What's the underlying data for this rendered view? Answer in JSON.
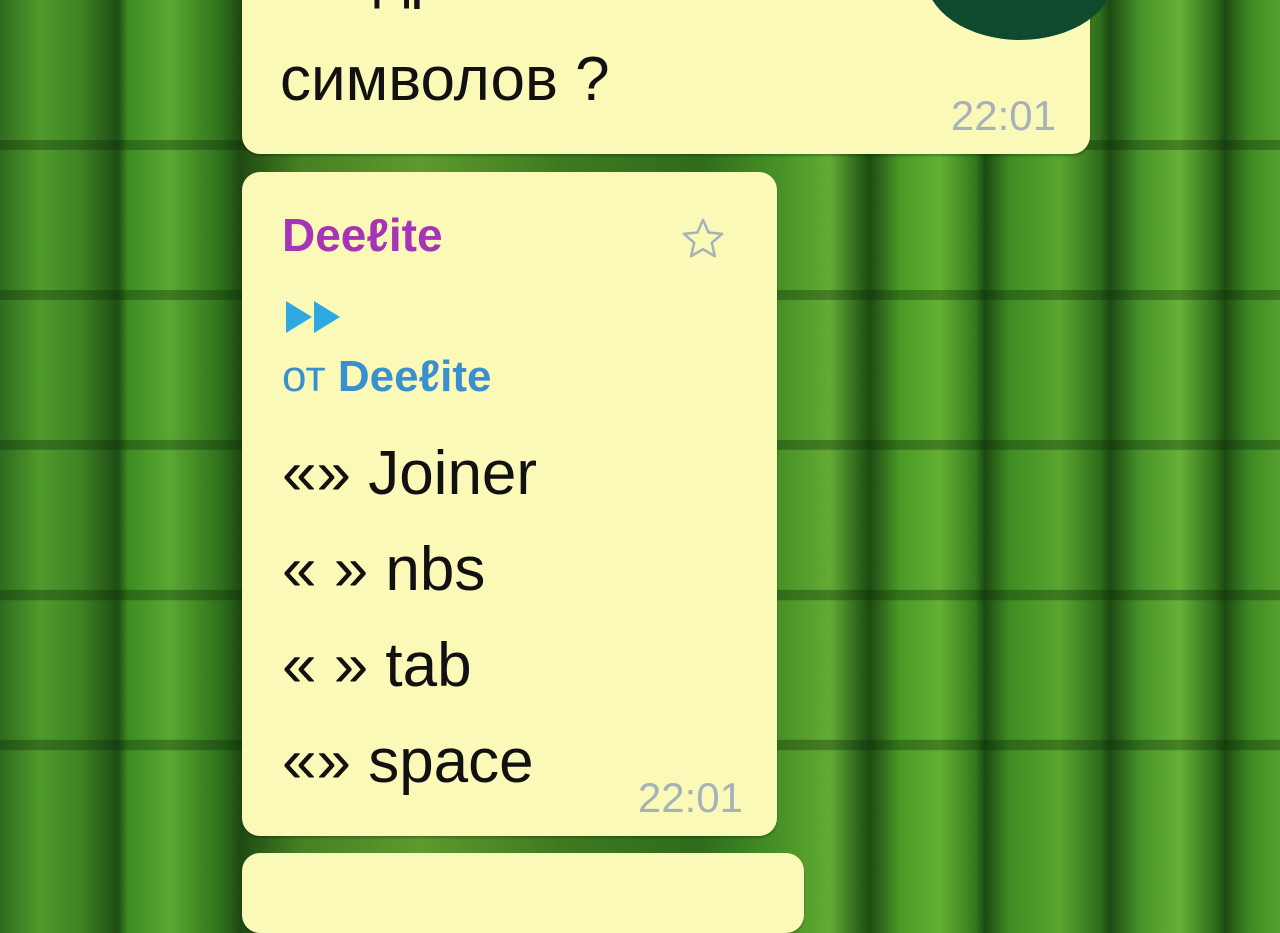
{
  "messages": [
    {
      "text_lines": [
        "квадратики вмес",
        "символов ?"
      ],
      "time": "22:01"
    },
    {
      "sender": "Deeℓite",
      "forwarded_prefix": "от",
      "forwarded_from": "Deeℓite",
      "text_lines": [
        "«‌» Joiner",
        "« » nbs",
        "«\t» tab",
        "«​» space"
      ],
      "time": "22:01"
    }
  ],
  "icons": {
    "star": "star-outline-icon",
    "forward": "forward-arrows-icon"
  },
  "colors": {
    "bubble": "#fbf9b8",
    "sender": "#a535b6",
    "forward": "#3a8fcf",
    "time": "#a6b2b8",
    "fab": "#0f4a2e"
  }
}
